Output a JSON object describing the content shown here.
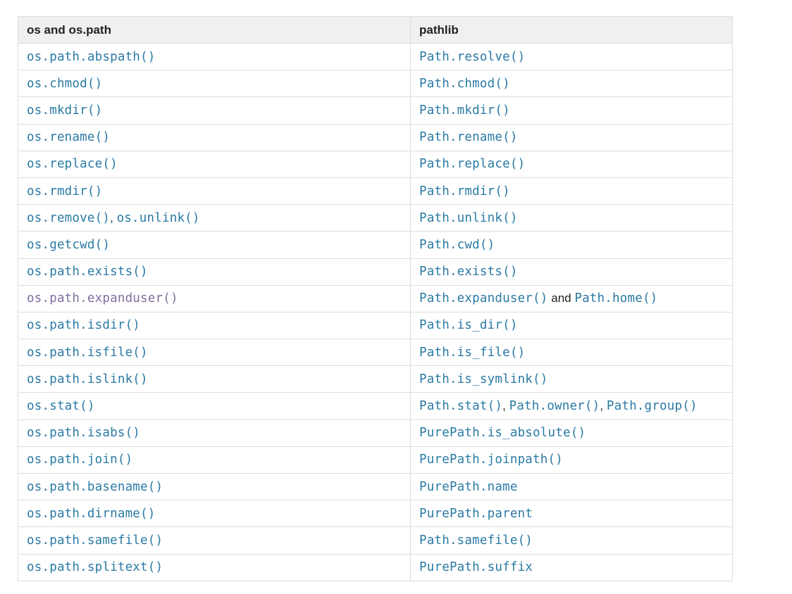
{
  "table": {
    "headers": [
      "os and os.path",
      "pathlib"
    ],
    "rows": [
      {
        "left": [
          {
            "t": "link",
            "v": "os.path.abspath()"
          }
        ],
        "right": [
          {
            "t": "link",
            "v": "Path.resolve()"
          }
        ]
      },
      {
        "left": [
          {
            "t": "link",
            "v": "os.chmod()"
          }
        ],
        "right": [
          {
            "t": "link",
            "v": "Path.chmod()"
          }
        ]
      },
      {
        "left": [
          {
            "t": "link",
            "v": "os.mkdir()"
          }
        ],
        "right": [
          {
            "t": "link",
            "v": "Path.mkdir()"
          }
        ]
      },
      {
        "left": [
          {
            "t": "link",
            "v": "os.rename()"
          }
        ],
        "right": [
          {
            "t": "link",
            "v": "Path.rename()"
          }
        ]
      },
      {
        "left": [
          {
            "t": "link",
            "v": "os.replace()"
          }
        ],
        "right": [
          {
            "t": "link",
            "v": "Path.replace()"
          }
        ]
      },
      {
        "left": [
          {
            "t": "link",
            "v": "os.rmdir()"
          }
        ],
        "right": [
          {
            "t": "link",
            "v": "Path.rmdir()"
          }
        ]
      },
      {
        "left": [
          {
            "t": "link",
            "v": "os.remove()"
          },
          {
            "t": "text",
            "v": ", "
          },
          {
            "t": "link",
            "v": "os.unlink()"
          }
        ],
        "right": [
          {
            "t": "link",
            "v": "Path.unlink()"
          }
        ]
      },
      {
        "left": [
          {
            "t": "link",
            "v": "os.getcwd()"
          }
        ],
        "right": [
          {
            "t": "link",
            "v": "Path.cwd()"
          }
        ]
      },
      {
        "left": [
          {
            "t": "link",
            "v": "os.path.exists()"
          }
        ],
        "right": [
          {
            "t": "link",
            "v": "Path.exists()"
          }
        ]
      },
      {
        "left": [
          {
            "t": "visited",
            "v": "os.path.expanduser()"
          }
        ],
        "right": [
          {
            "t": "link",
            "v": "Path.expanduser()"
          },
          {
            "t": "text",
            "v": " and "
          },
          {
            "t": "link",
            "v": "Path.home()"
          }
        ]
      },
      {
        "left": [
          {
            "t": "link",
            "v": "os.path.isdir()"
          }
        ],
        "right": [
          {
            "t": "link",
            "v": "Path.is_dir()"
          }
        ]
      },
      {
        "left": [
          {
            "t": "link",
            "v": "os.path.isfile()"
          }
        ],
        "right": [
          {
            "t": "link",
            "v": "Path.is_file()"
          }
        ]
      },
      {
        "left": [
          {
            "t": "link",
            "v": "os.path.islink()"
          }
        ],
        "right": [
          {
            "t": "link",
            "v": "Path.is_symlink()"
          }
        ]
      },
      {
        "left": [
          {
            "t": "link",
            "v": "os.stat()"
          }
        ],
        "right": [
          {
            "t": "link",
            "v": "Path.stat()"
          },
          {
            "t": "text",
            "v": ", "
          },
          {
            "t": "link",
            "v": "Path.owner()"
          },
          {
            "t": "text",
            "v": ", "
          },
          {
            "t": "link",
            "v": "Path.group()"
          }
        ]
      },
      {
        "left": [
          {
            "t": "link",
            "v": "os.path.isabs()"
          }
        ],
        "right": [
          {
            "t": "link",
            "v": "PurePath.is_absolute()"
          }
        ]
      },
      {
        "left": [
          {
            "t": "link",
            "v": "os.path.join()"
          }
        ],
        "right": [
          {
            "t": "link",
            "v": "PurePath.joinpath()"
          }
        ]
      },
      {
        "left": [
          {
            "t": "link",
            "v": "os.path.basename()"
          }
        ],
        "right": [
          {
            "t": "link",
            "v": "PurePath.name"
          }
        ]
      },
      {
        "left": [
          {
            "t": "link",
            "v": "os.path.dirname()"
          }
        ],
        "right": [
          {
            "t": "link",
            "v": "PurePath.parent"
          }
        ]
      },
      {
        "left": [
          {
            "t": "link",
            "v": "os.path.samefile()"
          }
        ],
        "right": [
          {
            "t": "link",
            "v": "Path.samefile()"
          }
        ]
      },
      {
        "left": [
          {
            "t": "link",
            "v": "os.path.splitext()"
          }
        ],
        "right": [
          {
            "t": "link",
            "v": "PurePath.suffix"
          }
        ]
      }
    ]
  },
  "colors": {
    "link": "#2a7aa3",
    "visited_link": "#7f6d9e",
    "header_bg": "#f0f0f0",
    "border": "#dddddd",
    "text": "#222222"
  }
}
